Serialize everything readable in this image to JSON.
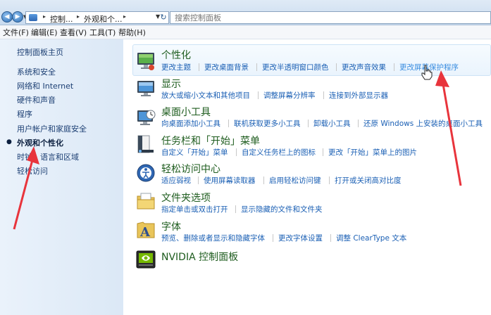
{
  "address": {
    "crumbs": [
      "控制...",
      "外观和个..."
    ],
    "search_placeholder": "搜索控制面板"
  },
  "menu": [
    "文件(F)",
    "编辑(E)",
    "查看(V)",
    "工具(T)",
    "帮助(H)"
  ],
  "sidebar": {
    "items": [
      {
        "label": "控制面板主页"
      },
      {
        "label": "系统和安全"
      },
      {
        "label": "网络和 Internet"
      },
      {
        "label": "硬件和声音"
      },
      {
        "label": "程序"
      },
      {
        "label": "用户帐户和家庭安全"
      },
      {
        "label": "外观和个性化",
        "active": true
      },
      {
        "label": "时钟、语言和区域"
      },
      {
        "label": "轻松访问"
      }
    ]
  },
  "categories": [
    {
      "title": "个性化",
      "icon": "personalization-icon",
      "links": [
        "更改主题",
        "更改桌面背景",
        "更改半透明窗口颜色",
        "更改声音效果",
        "更改屏幕保护程序"
      ]
    },
    {
      "title": "显示",
      "icon": "display-icon",
      "links": [
        "放大或缩小文本和其他项目",
        "调整屏幕分辨率",
        "连接到外部显示器"
      ]
    },
    {
      "title": "桌面小工具",
      "icon": "gadgets-icon",
      "links": [
        "向桌面添加小工具",
        "联机获取更多小工具",
        "卸载小工具",
        "还原 Windows 上安装的桌面小工具"
      ]
    },
    {
      "title": "任务栏和「开始」菜单",
      "icon": "taskbar-icon",
      "links": [
        "自定义「开始」菜单",
        "自定义任务栏上的图标",
        "更改「开始」菜单上的图片"
      ]
    },
    {
      "title": "轻松访问中心",
      "icon": "ease-of-access-icon",
      "links": [
        "适应弱视",
        "使用屏幕读取器",
        "启用轻松访问键",
        "打开或关闭高对比度"
      ]
    },
    {
      "title": "文件夹选项",
      "icon": "folder-options-icon",
      "links": [
        "指定单击或双击打开",
        "显示隐藏的文件和文件夹"
      ]
    },
    {
      "title": "字体",
      "icon": "fonts-icon",
      "links": [
        "预览、删除或者显示和隐藏字体",
        "更改字体设置",
        "调整 ClearType 文本"
      ]
    },
    {
      "title": "NVIDIA 控制面板",
      "icon": "nvidia-icon",
      "links": []
    }
  ],
  "colors": {
    "link": "#1a5fb4",
    "category_title": "#1e5c1e",
    "annotation_arrow": "#e8343c"
  }
}
